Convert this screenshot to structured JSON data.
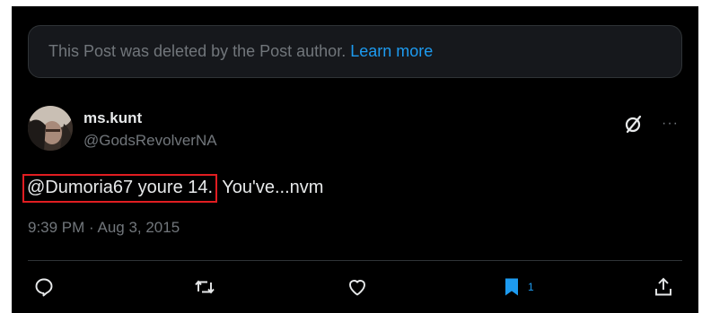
{
  "deleted_notice": {
    "text": "This Post was deleted by the Post author.",
    "link": "Learn more"
  },
  "post": {
    "display_name": "ms.kunt",
    "handle": "@GodsRevolverNA",
    "text_highlighted": "@Dumoria67 youre 14.",
    "text_rest": " You've...nvm",
    "timestamp": "9:39 PM · Aug 3, 2015",
    "more": "···"
  },
  "actions": {
    "reply_icon": "reply-icon",
    "repost_icon": "repost-icon",
    "like_icon": "like-icon",
    "bookmark_icon": "bookmark-icon",
    "bookmark_count": "1",
    "share_icon": "share-icon"
  },
  "colors": {
    "background": "#000000",
    "accent": "#1d9bf0",
    "muted": "#71767b",
    "text": "#e7e9ea",
    "highlight_border": "#e11d21"
  }
}
